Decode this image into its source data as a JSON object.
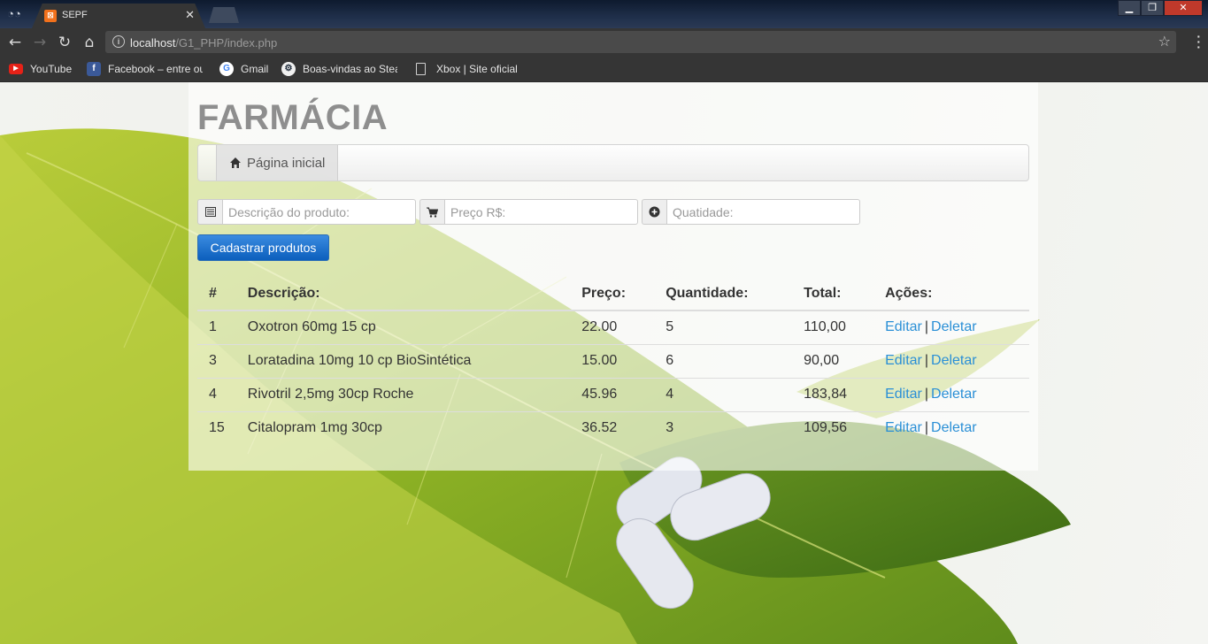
{
  "browser": {
    "tab_title": "SEPF",
    "tab_favicon": "xampp-icon",
    "url_host": "localhost",
    "url_path": "/G1_PHP/index.php",
    "bookmarks": [
      {
        "label": "YouTube",
        "icon": "youtube-icon"
      },
      {
        "label": "Facebook – entre ou",
        "icon": "facebook-icon"
      },
      {
        "label": "Gmail",
        "icon": "google-icon"
      },
      {
        "label": "Boas-vindas ao Stear",
        "icon": "steam-icon"
      },
      {
        "label": "Xbox | Site oficial",
        "icon": "page-icon"
      }
    ]
  },
  "page": {
    "brand": "FARMÁCIA",
    "nav_home": "Página inicial",
    "form": {
      "descricao_placeholder": "Descrição do produto:",
      "preco_placeholder": "Preço R$:",
      "quantidade_placeholder": "Quatidade:",
      "submit_label": "Cadastrar produtos"
    },
    "table": {
      "headers": [
        "#",
        "Descrição:",
        "Preço:",
        "Quantidade:",
        "Total:",
        "Ações:"
      ],
      "edit_label": "Editar",
      "delete_label": "Deletar",
      "separator": "|",
      "rows": [
        {
          "id": "1",
          "descricao": "Oxotron 60mg 15 cp",
          "preco": "22.00",
          "quantidade": "5",
          "total": "110,00"
        },
        {
          "id": "3",
          "descricao": "Loratadina 10mg 10 cp BioSintética",
          "preco": "15.00",
          "quantidade": "6",
          "total": "90,00"
        },
        {
          "id": "4",
          "descricao": "Rivotril 2,5mg 30cp Roche",
          "preco": "45.96",
          "quantidade": "4",
          "total": "183,84"
        },
        {
          "id": "15",
          "descricao": "Citalopram 1mg 30cp",
          "preco": "36.52",
          "quantidade": "3",
          "total": "109,56"
        }
      ]
    }
  },
  "colors": {
    "brand_text": "#8e8e8e",
    "link": "#2a8fd6",
    "primary_button": "#0c5fbd",
    "leaf_green": "#8fb325"
  }
}
